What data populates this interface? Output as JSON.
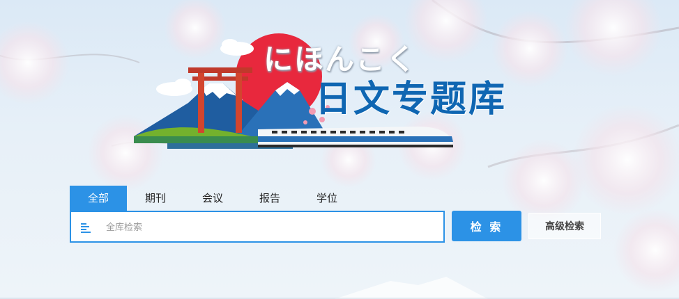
{
  "header": {
    "title_kana": "にほんこく",
    "title_main": "日文专题库"
  },
  "tabs": [
    {
      "label": "全部",
      "active": true
    },
    {
      "label": "期刊",
      "active": false
    },
    {
      "label": "会议",
      "active": false
    },
    {
      "label": "报告",
      "active": false
    },
    {
      "label": "学位",
      "active": false
    }
  ],
  "search": {
    "placeholder": "全库检索",
    "value": "",
    "type_icon": "list-align-icon",
    "submit_label": "检 索",
    "advanced_label": "高级检索"
  },
  "colors": {
    "accent": "#2c92e6",
    "title_blue": "#0f66b2",
    "sun_red": "#e8283d"
  }
}
